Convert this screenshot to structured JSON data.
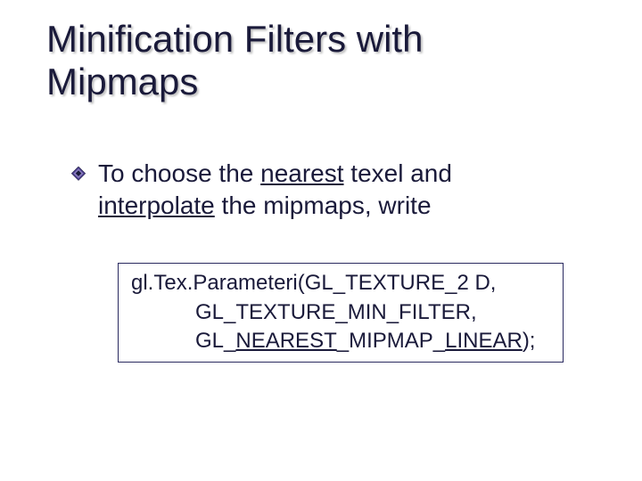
{
  "title": {
    "line1": "Minification Filters with",
    "line2": "Mipmaps"
  },
  "bullet": {
    "pre1": "To choose the ",
    "em1": "nearest",
    "mid1": " texel and",
    "em2": "interpolate",
    "post2": " the mipmaps, write"
  },
  "code": {
    "line1": "gl.Tex.Parameteri(GL_TEXTURE_2 D,",
    "line2": "GL_TEXTURE_MIN_FILTER,",
    "l3a": "GL_",
    "l3b": "NEAREST",
    "l3c": "_MIPMAP_",
    "l3d": "LINEAR",
    "l3e": ");"
  }
}
